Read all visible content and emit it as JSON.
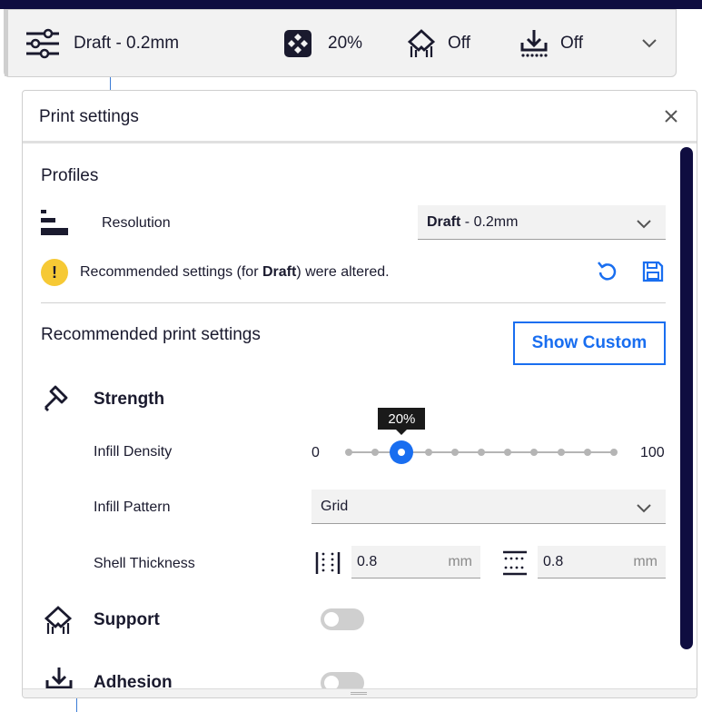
{
  "header": {
    "profile_label": "Draft - 0.2mm",
    "infill_value": "20%",
    "support_value": "Off",
    "adhesion_value": "Off"
  },
  "panel": {
    "title": "Print settings",
    "profiles": {
      "heading": "Profiles",
      "resolution_label": "Resolution",
      "resolution_bold": "Draft",
      "resolution_rest": " - 0.2mm",
      "warning_prefix": "Recommended settings (for ",
      "warning_bold": "Draft",
      "warning_suffix": ") were altered."
    },
    "recommended": {
      "heading": "Recommended print settings",
      "show_custom_label": "Show Custom"
    },
    "strength": {
      "heading": "Strength",
      "infill_density_label": "Infill Density",
      "slider_min": "0",
      "slider_max": "100",
      "slider_tooltip": "20%",
      "slider_value": 20,
      "infill_pattern_label": "Infill Pattern",
      "infill_pattern_value": "Grid",
      "shell_thickness_label": "Shell Thickness",
      "wall_value": "0.8",
      "wall_unit": "mm",
      "topbottom_value": "0.8",
      "topbottom_unit": "mm"
    },
    "support": {
      "heading": "Support",
      "enabled": false
    },
    "adhesion": {
      "heading": "Adhesion",
      "enabled": false
    }
  },
  "colors": {
    "accent": "#196ef0",
    "dark_navy": "#0f0d40",
    "warning": "#f6c935",
    "field_bg": "#f2f2f2"
  },
  "icons": {
    "profile": "sliders-icon",
    "infill": "infill-icon",
    "support": "support-icon",
    "adhesion": "adhesion-icon",
    "expand": "chevron-down-icon",
    "close": "close-icon",
    "resolution": "resolution-icon",
    "warning": "warning-icon",
    "reset": "reset-icon",
    "save": "save-icon",
    "strength": "hammer-icon",
    "wall_thickness": "wall-thickness-icon",
    "top_bottom_thickness": "top-bottom-thickness-icon"
  }
}
